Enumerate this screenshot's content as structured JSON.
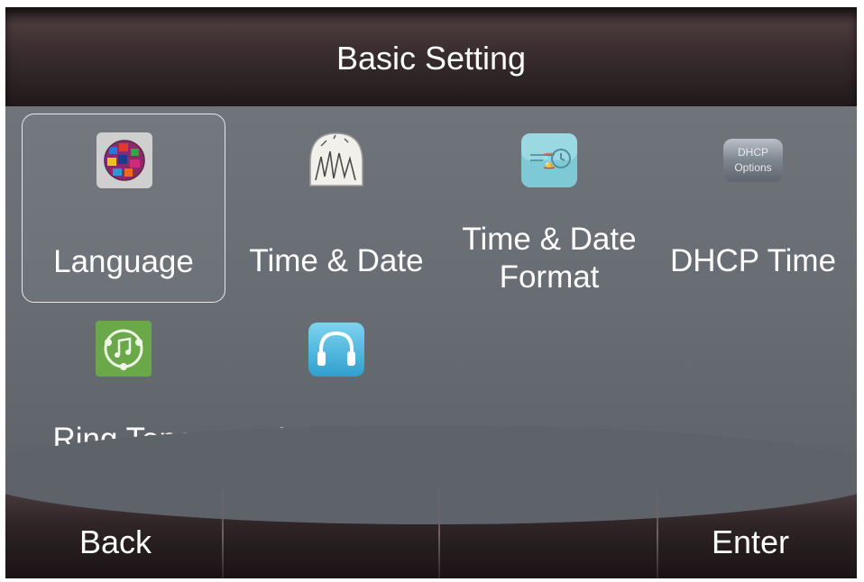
{
  "header": {
    "title": "Basic Setting"
  },
  "menu": {
    "items": [
      {
        "label": "Language",
        "icon": "language-globe-icon",
        "selected": true
      },
      {
        "label": "Time & Date",
        "icon": "clock-time-date-icon",
        "selected": false
      },
      {
        "label_line1": "Time & Date",
        "label_line2": "Format",
        "icon": "time-format-icon",
        "selected": false
      },
      {
        "label": "DHCP Time",
        "icon": "dhcp-options-icon",
        "icon_text_line1": "DHCP",
        "icon_text_line2": "Options",
        "selected": false
      },
      {
        "label": "Ring Tone",
        "icon": "ring-tone-music-icon",
        "selected": false
      },
      {
        "label": "Headset",
        "icon": "headset-icon",
        "selected": false
      }
    ]
  },
  "softkeys": {
    "key1": "Back",
    "key2": "",
    "key3": "",
    "key4": "Enter"
  },
  "colors": {
    "background": "#6a6f76",
    "titlebar": "#3a2d2f",
    "selection_border": "#e8e8ea",
    "text": "#ffffff"
  }
}
